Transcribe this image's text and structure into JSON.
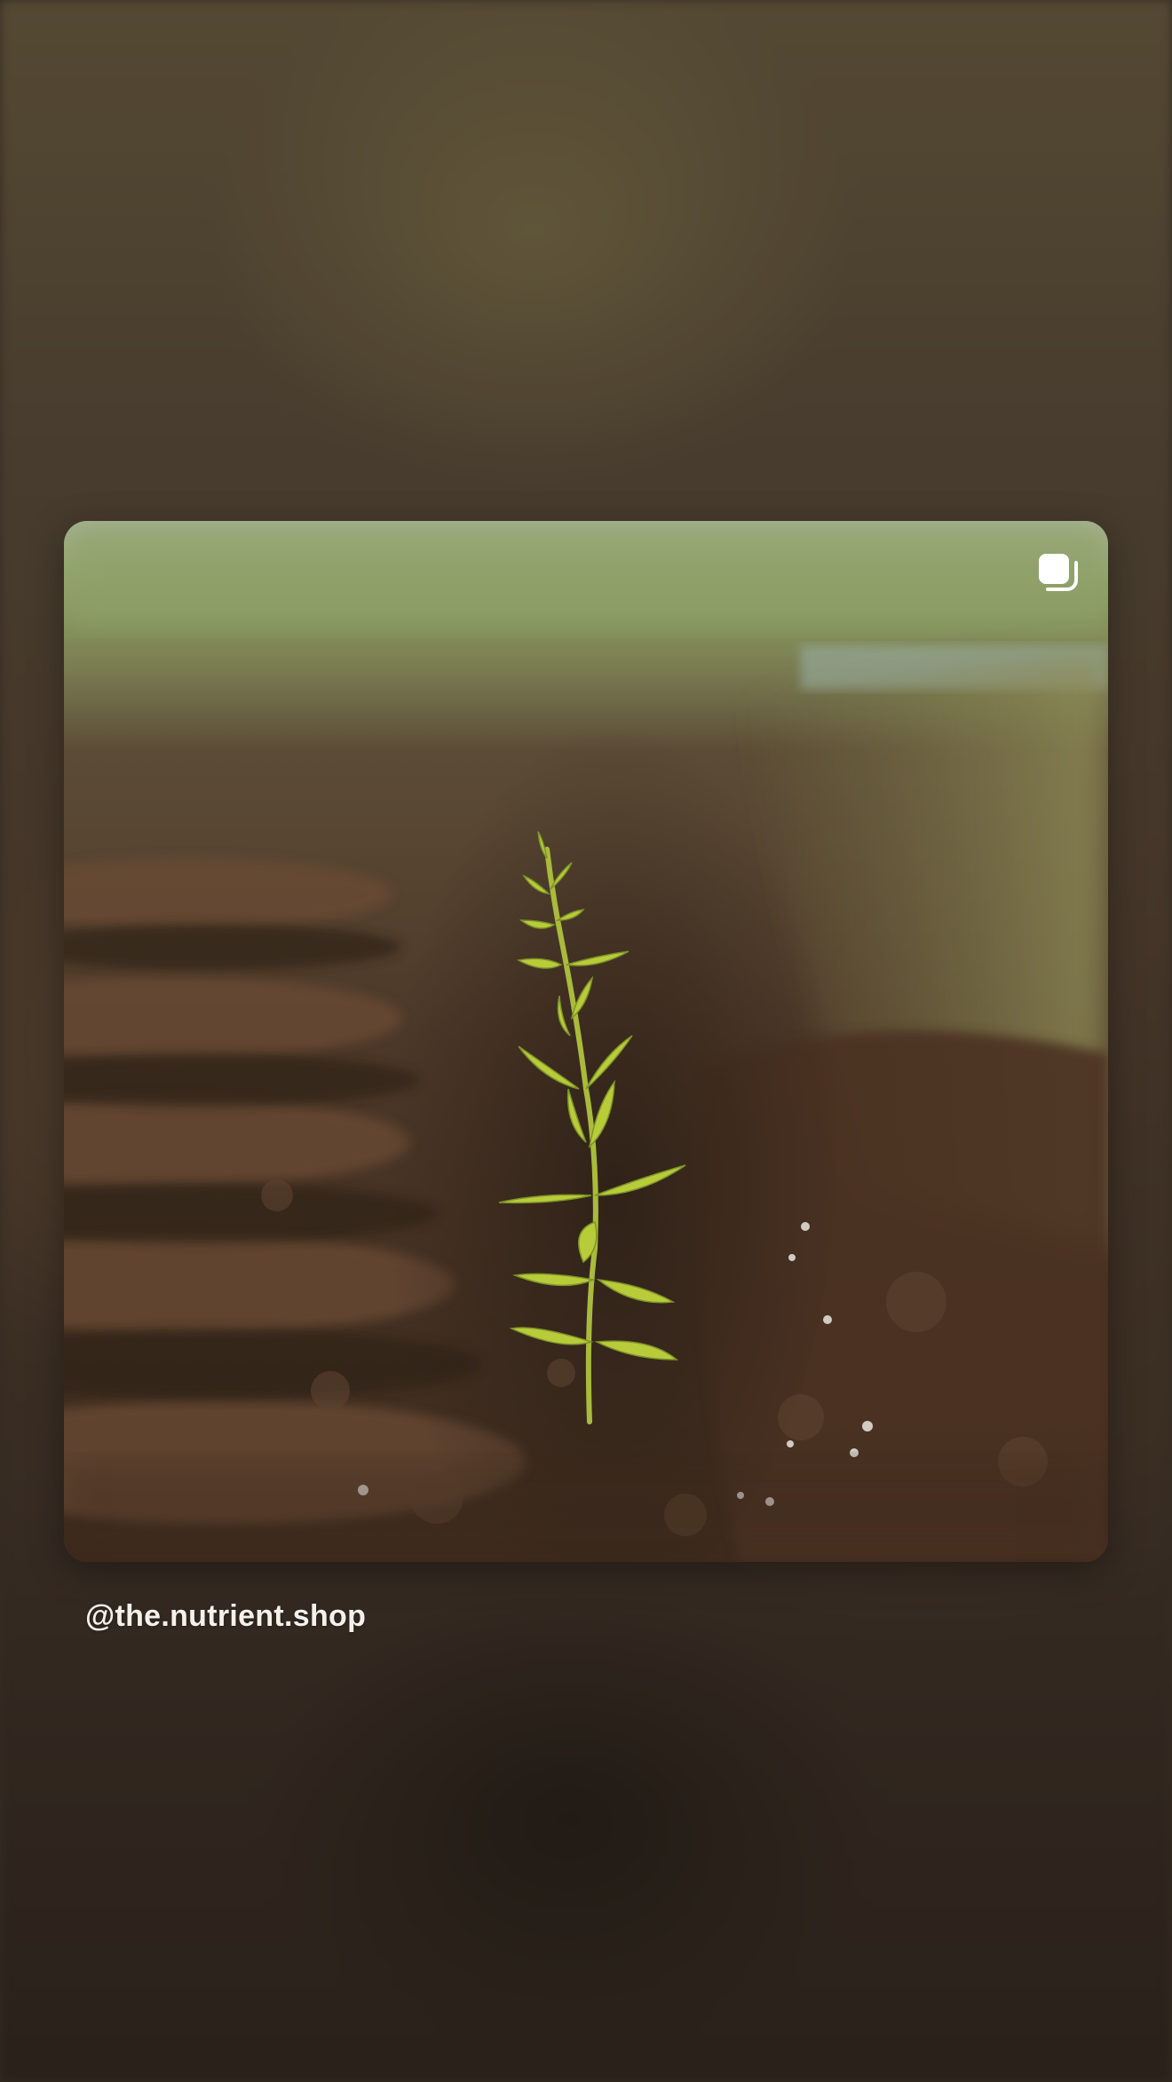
{
  "post": {
    "username": "@the.nutrient.shop",
    "image_icon": "multiple-images-icon"
  },
  "colors": {
    "soil": "#4a3626",
    "sprout": "#b8cc3a",
    "username_text": "#f4f1ec"
  }
}
